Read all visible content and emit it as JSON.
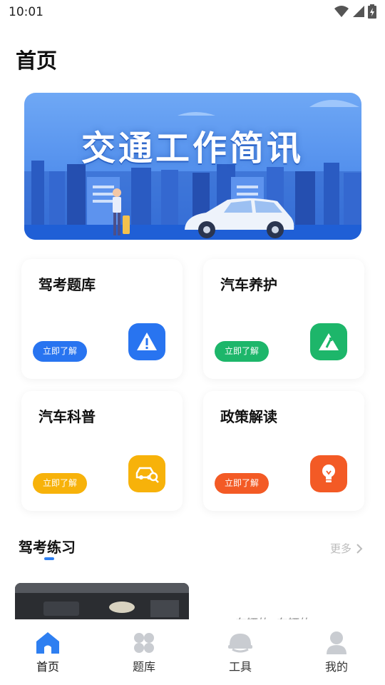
{
  "status_bar": {
    "time": "10:01",
    "icons": [
      "wifi-icon",
      "signal-icon",
      "battery-icon"
    ]
  },
  "page": {
    "title": "首页"
  },
  "banner": {
    "title": "交通工作简讯"
  },
  "cards": [
    {
      "title": "驾考题库",
      "button": "立即了解",
      "color": "#2874f0",
      "icon": "warning-icon"
    },
    {
      "title": "汽车养护",
      "button": "立即了解",
      "color": "#1db66a",
      "icon": "road-icon"
    },
    {
      "title": "汽车科普",
      "button": "立即了解",
      "color": "#f7b20a",
      "icon": "car-search-icon"
    },
    {
      "title": "政策解读",
      "button": "立即了解",
      "color": "#f35a25",
      "icon": "lightbulb-icon"
    }
  ],
  "section": {
    "title": "驾考练习",
    "more": "更多"
  },
  "practice": {
    "item_text": "车辆的..车辆的"
  },
  "tabs": [
    {
      "label": "首页",
      "icon": "home-icon",
      "active": true
    },
    {
      "label": "题库",
      "icon": "grid-icon",
      "active": false
    },
    {
      "label": "工具",
      "icon": "helmet-icon",
      "active": false
    },
    {
      "label": "我的",
      "icon": "user-icon",
      "active": false
    }
  ]
}
